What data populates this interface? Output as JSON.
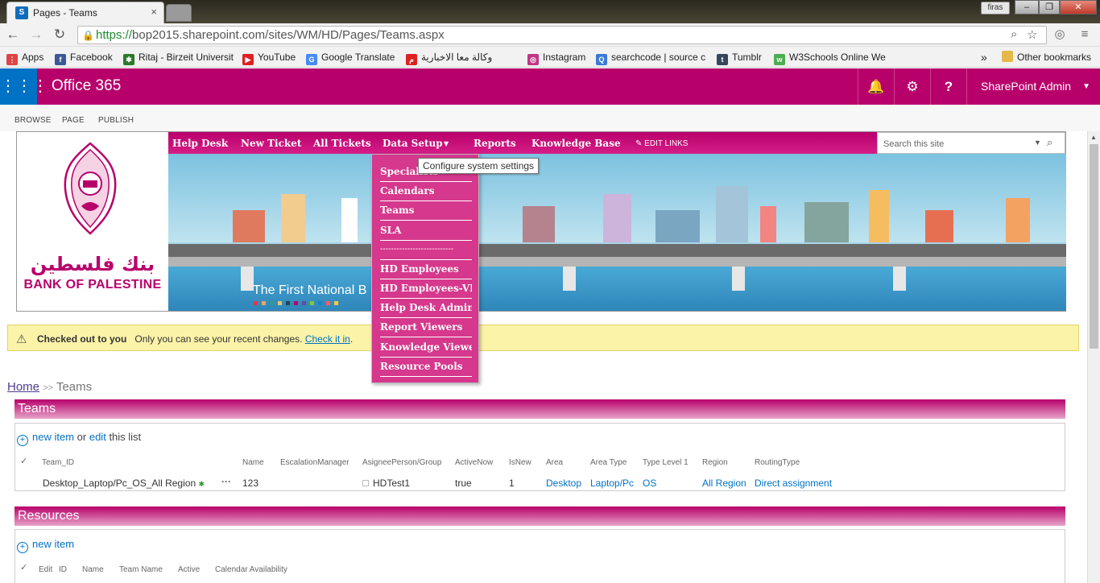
{
  "browser": {
    "tab_title": "Pages - Teams",
    "tab_close": "×",
    "profile": "firas",
    "url_https": "https://",
    "url_rest": "bop2015.sharepoint.com/sites/WM/HD/Pages/Teams.aspx",
    "bookmarks": [
      "Apps",
      "Facebook",
      "Ritaj - Birzeit Universit",
      "YouTube",
      "Google Translate",
      "وكالة معا الاخبارية",
      "Instagram",
      "searchcode | source c",
      "Tumblr",
      "W3Schools Online We"
    ],
    "overflow": "»",
    "other_bookmarks": "Other bookmarks"
  },
  "suitebar": {
    "brand": "Office 365",
    "user": "SharePoint Admin"
  },
  "ribbon": {
    "tabs": [
      "BROWSE",
      "PAGE",
      "PUBLISH"
    ]
  },
  "logo": {
    "arabic": "بنك فلسطين",
    "english": "BANK OF PALESTINE"
  },
  "topnav": {
    "items": [
      "Help Desk",
      "New Ticket",
      "All Tickets",
      "Data Setup",
      "Reports",
      "Knowledge Base"
    ],
    "edit_links": "EDIT LINKS",
    "search_placeholder": "Search this site"
  },
  "banner": {
    "text": "The First National B"
  },
  "dropdown": {
    "items": [
      "Specialists",
      "Calendars",
      "Teams",
      "SLA",
      "---------------------------",
      "HD Employees",
      "HD Employees-VIP",
      "Help Desk Admin",
      "Report Viewers",
      "Knowledge Viewers",
      "Resource Pools"
    ],
    "tooltip": "Configure system settings"
  },
  "notice": {
    "title": "Checked out to you",
    "message": "Only you can see your recent changes.",
    "link": "Check it in",
    "period": "."
  },
  "breadcrumb": {
    "home": "Home",
    "sep": ">>",
    "current": "Teams"
  },
  "teams": {
    "title": "Teams",
    "new_item": "new item",
    "or": "or",
    "edit": "edit",
    "this_list": "this list",
    "columns": [
      "Team_ID",
      "Name",
      "EscalationManager",
      "AsigneePerson/Group",
      "ActiveNow",
      "IsNew",
      "Area",
      "Area Type",
      "Type Level 1",
      "Region",
      "RoutingType"
    ],
    "row": {
      "team_id": "Desktop_Laptop/Pc_OS_All Region",
      "dots": "···",
      "name": "123",
      "assignee": "HDTest1",
      "active_now": "true",
      "is_new": "1",
      "area": "Desktop",
      "area_type": "Laptop/Pc",
      "type_level_1": "OS",
      "region": "All Region",
      "routing": "Direct assignment"
    }
  },
  "resources": {
    "title": "Resources",
    "new_item": "new item",
    "columns": [
      "Edit",
      "ID",
      "Name",
      "Team Name",
      "Active",
      "Calendar Availability"
    ]
  },
  "colors": {
    "brand": "#b8006b",
    "suite_blue": "#0072c6",
    "dropdown": "#d5388c",
    "notice": "#fbf3a8"
  }
}
